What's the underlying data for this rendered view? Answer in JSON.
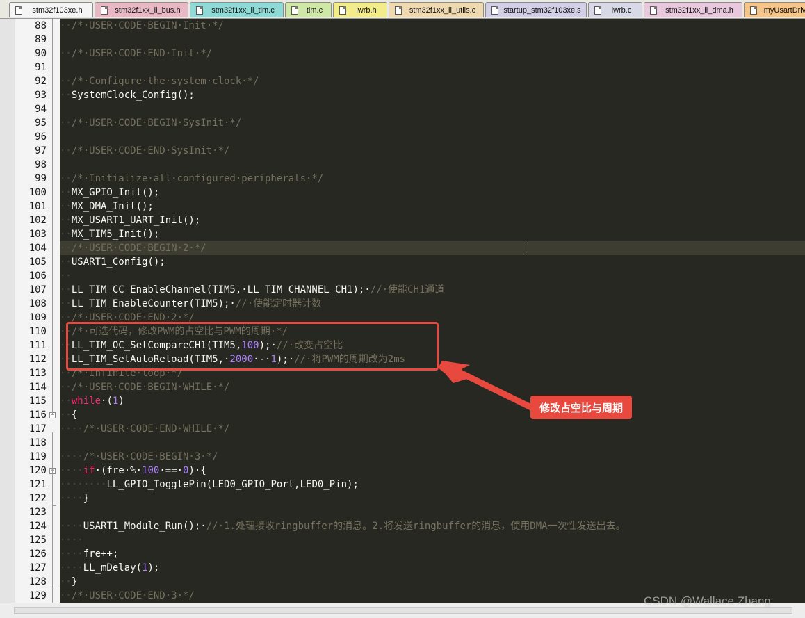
{
  "tabs": [
    {
      "label": "stm32f103xe.h",
      "color": "#f5f5f5",
      "icon": "doc-icon"
    },
    {
      "label": "stm32f1xx_ll_bus.h",
      "color": "#e8b8c4",
      "icon": "doc-icon"
    },
    {
      "label": "stm32f1xx_ll_tim.c",
      "color": "#8fd9d6",
      "icon": "doc-modified-icon"
    },
    {
      "label": "tim.c",
      "color": "#cfe8a8",
      "icon": "doc-modified-icon"
    },
    {
      "label": "lwrb.h",
      "color": "#f3ec8a",
      "icon": "doc-icon"
    },
    {
      "label": "stm32f1xx_ll_utils.c",
      "color": "#efd9b0",
      "icon": "doc-icon"
    },
    {
      "label": "startup_stm32f103xe.s",
      "color": "#d2cfe6",
      "icon": "doc-icon"
    },
    {
      "label": "lwrb.c",
      "color": "#d8d8e6",
      "icon": "doc-icon"
    },
    {
      "label": "stm32f1xx_ll_dma.h",
      "color": "#e8c8dc",
      "icon": "doc-icon"
    },
    {
      "label": "myUsartDriv",
      "color": "#f6c58a",
      "icon": "doc-icon"
    }
  ],
  "editor": {
    "theme_bg": "#272822",
    "current_line": 104,
    "lines": [
      {
        "n": "88",
        "segs": [
          [
            "ws",
            "··"
          ],
          [
            "cm",
            "/*·USER·CODE·BEGIN·Init·*/"
          ]
        ]
      },
      {
        "n": "89",
        "segs": []
      },
      {
        "n": "90",
        "segs": [
          [
            "ws",
            "··"
          ],
          [
            "cm",
            "/*·USER·CODE·END·Init·*/"
          ]
        ]
      },
      {
        "n": "91",
        "segs": []
      },
      {
        "n": "92",
        "segs": [
          [
            "ws",
            "··"
          ],
          [
            "cm",
            "/*·Configure·the·system·clock·*/"
          ]
        ]
      },
      {
        "n": "93",
        "segs": [
          [
            "ws",
            "··"
          ],
          [
            "df",
            "SystemClock_Config();"
          ]
        ]
      },
      {
        "n": "94",
        "segs": []
      },
      {
        "n": "95",
        "segs": [
          [
            "ws",
            "··"
          ],
          [
            "cm",
            "/*·USER·CODE·BEGIN·SysInit·*/"
          ]
        ]
      },
      {
        "n": "96",
        "segs": []
      },
      {
        "n": "97",
        "segs": [
          [
            "ws",
            "··"
          ],
          [
            "cm",
            "/*·USER·CODE·END·SysInit·*/"
          ]
        ]
      },
      {
        "n": "98",
        "segs": []
      },
      {
        "n": "99",
        "segs": [
          [
            "ws",
            "··"
          ],
          [
            "cm",
            "/*·Initialize·all·configured·peripherals·*/"
          ]
        ]
      },
      {
        "n": "100",
        "segs": [
          [
            "ws",
            "··"
          ],
          [
            "df",
            "MX_GPIO_Init();"
          ]
        ]
      },
      {
        "n": "101",
        "segs": [
          [
            "ws",
            "··"
          ],
          [
            "df",
            "MX_DMA_Init();"
          ]
        ]
      },
      {
        "n": "102",
        "segs": [
          [
            "ws",
            "··"
          ],
          [
            "df",
            "MX_USART1_UART_Init();"
          ]
        ]
      },
      {
        "n": "103",
        "segs": [
          [
            "ws",
            "··"
          ],
          [
            "df",
            "MX_TIM5_Init();"
          ]
        ]
      },
      {
        "n": "104",
        "segs": [
          [
            "ws",
            "··"
          ],
          [
            "cm",
            "/*·USER·CODE·BEGIN·2·*/"
          ]
        ]
      },
      {
        "n": "105",
        "segs": [
          [
            "ws",
            "··"
          ],
          [
            "df",
            "USART1_Config();"
          ]
        ]
      },
      {
        "n": "106",
        "segs": [
          [
            "ws",
            "··"
          ]
        ]
      },
      {
        "n": "107",
        "segs": [
          [
            "ws",
            "··"
          ],
          [
            "df",
            "LL_TIM_CC_EnableChannel(TIM5,·LL_TIM_CHANNEL_CH1);·"
          ],
          [
            "cm",
            "//·使能CH1通道"
          ]
        ]
      },
      {
        "n": "108",
        "segs": [
          [
            "ws",
            "··"
          ],
          [
            "df",
            "LL_TIM_EnableCounter(TIM5);·"
          ],
          [
            "cm",
            "//·使能定时器计数"
          ]
        ]
      },
      {
        "n": "109",
        "segs": [
          [
            "ws",
            "··"
          ],
          [
            "cm",
            "/*·USER·CODE·END·2·*/"
          ]
        ]
      },
      {
        "n": "110",
        "segs": [
          [
            "ws",
            "··"
          ],
          [
            "cm",
            "/*·可选代码，修改PWM的占空比与PWM的周期·*/"
          ]
        ]
      },
      {
        "n": "111",
        "segs": [
          [
            "ws",
            "··"
          ],
          [
            "df",
            "LL_TIM_OC_SetCompareCH1(TIM5,"
          ],
          [
            "nm",
            "100"
          ],
          [
            "df",
            ");·"
          ],
          [
            "cm",
            "//·改变占空比"
          ]
        ]
      },
      {
        "n": "112",
        "segs": [
          [
            "ws",
            "··"
          ],
          [
            "df",
            "LL_TIM_SetAutoReload(TIM5,·"
          ],
          [
            "nm",
            "2000"
          ],
          [
            "df",
            "·-·"
          ],
          [
            "nm",
            "1"
          ],
          [
            "df",
            ");·"
          ],
          [
            "cm",
            "//·将PWM的周期改为2ms"
          ]
        ]
      },
      {
        "n": "113",
        "segs": [
          [
            "ws",
            "··"
          ],
          [
            "cm",
            "/*·Infinite·loop·*/"
          ]
        ]
      },
      {
        "n": "114",
        "segs": [
          [
            "ws",
            "··"
          ],
          [
            "cm",
            "/*·USER·CODE·BEGIN·WHILE·*/"
          ]
        ]
      },
      {
        "n": "115",
        "segs": [
          [
            "ws",
            "··"
          ],
          [
            "kw",
            "while"
          ],
          [
            "df",
            "·("
          ],
          [
            "nm",
            "1"
          ],
          [
            "df",
            ")"
          ]
        ]
      },
      {
        "n": "116",
        "segs": [
          [
            "ws",
            "··"
          ],
          [
            "df",
            "{"
          ]
        ],
        "fold": "open"
      },
      {
        "n": "117",
        "segs": [
          [
            "ws",
            "····"
          ],
          [
            "cm",
            "/*·USER·CODE·END·WHILE·*/"
          ]
        ]
      },
      {
        "n": "118",
        "segs": []
      },
      {
        "n": "119",
        "segs": [
          [
            "ws",
            "····"
          ],
          [
            "cm",
            "/*·USER·CODE·BEGIN·3·*/"
          ]
        ]
      },
      {
        "n": "120",
        "segs": [
          [
            "ws",
            "····"
          ],
          [
            "kw",
            "if"
          ],
          [
            "df",
            "·(fre·%·"
          ],
          [
            "nm",
            "100"
          ],
          [
            "df",
            "·==·"
          ],
          [
            "nm",
            "0"
          ],
          [
            "df",
            ")·{"
          ]
        ],
        "fold": "open"
      },
      {
        "n": "121",
        "segs": [
          [
            "ws",
            "········"
          ],
          [
            "df",
            "LL_GPIO_TogglePin(LED0_GPIO_Port,LED0_Pin);"
          ]
        ]
      },
      {
        "n": "122",
        "segs": [
          [
            "ws",
            "····"
          ],
          [
            "df",
            "}"
          ]
        ]
      },
      {
        "n": "123",
        "segs": []
      },
      {
        "n": "124",
        "segs": [
          [
            "ws",
            "····"
          ],
          [
            "df",
            "USART1_Module_Run();·"
          ],
          [
            "cm",
            "//·1.处理接收ringbuffer的消息。2.将发送ringbuffer的消息，使用DMA一次性发送出去。"
          ]
        ]
      },
      {
        "n": "125",
        "segs": [
          [
            "ws",
            "····"
          ]
        ]
      },
      {
        "n": "126",
        "segs": [
          [
            "ws",
            "····"
          ],
          [
            "df",
            "fre++;"
          ]
        ]
      },
      {
        "n": "127",
        "segs": [
          [
            "ws",
            "····"
          ],
          [
            "df",
            "LL_mDelay("
          ],
          [
            "nm",
            "1"
          ],
          [
            "df",
            ");"
          ]
        ]
      },
      {
        "n": "128",
        "segs": [
          [
            "ws",
            "··"
          ],
          [
            "df",
            "}"
          ]
        ]
      },
      {
        "n": "129",
        "segs": [
          [
            "ws",
            "··"
          ],
          [
            "cm",
            "/*·USER·CODE·END·3·*/"
          ]
        ]
      }
    ]
  },
  "annotation": {
    "callout_text": "修改占空比与周期",
    "accent_color": "#e8493f"
  },
  "watermark": "CSDN @Wallace Zhang"
}
